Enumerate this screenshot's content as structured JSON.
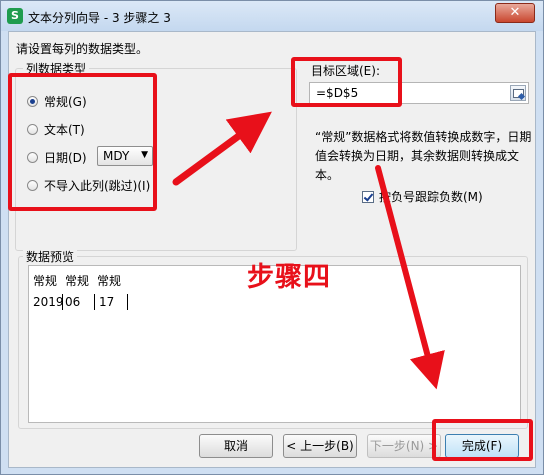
{
  "window": {
    "app_icon_glyph": "S",
    "title": "文本分列向导 - 3 步骤之 3",
    "close_glyph": "✕"
  },
  "instruction": "请设置每列的数据类型。",
  "column_type": {
    "group_title": "列数据类型",
    "options": [
      {
        "label": "常规(G)",
        "checked": true
      },
      {
        "label": "文本(T)",
        "checked": false
      },
      {
        "label": "日期(D)",
        "checked": false
      },
      {
        "label": "不导入此列(跳过)(I)",
        "checked": false
      }
    ],
    "date_format": "MDY",
    "date_dropdown_icon": "chevron-down-icon"
  },
  "target": {
    "label": "目标区域(E):",
    "value": "=$D$5",
    "range_button_icon": "range-select-icon"
  },
  "description": "“常规”数据格式将数值转换成数字，日期值会转换为日期，其余数据则转换成文本。",
  "negative_checkbox": {
    "label": "按负号跟踪负数(M)",
    "checked": true
  },
  "preview": {
    "group_title": "数据预览",
    "headers": [
      "常规",
      "常规",
      "常规"
    ],
    "row": [
      "2019",
      "06",
      "17"
    ]
  },
  "buttons": {
    "cancel": "取消",
    "back": "< 上一步(B)",
    "next": "下一步(N) >",
    "finish": "完成(F)"
  },
  "annotation": {
    "text": "步骤四",
    "color": "#e8101a"
  }
}
